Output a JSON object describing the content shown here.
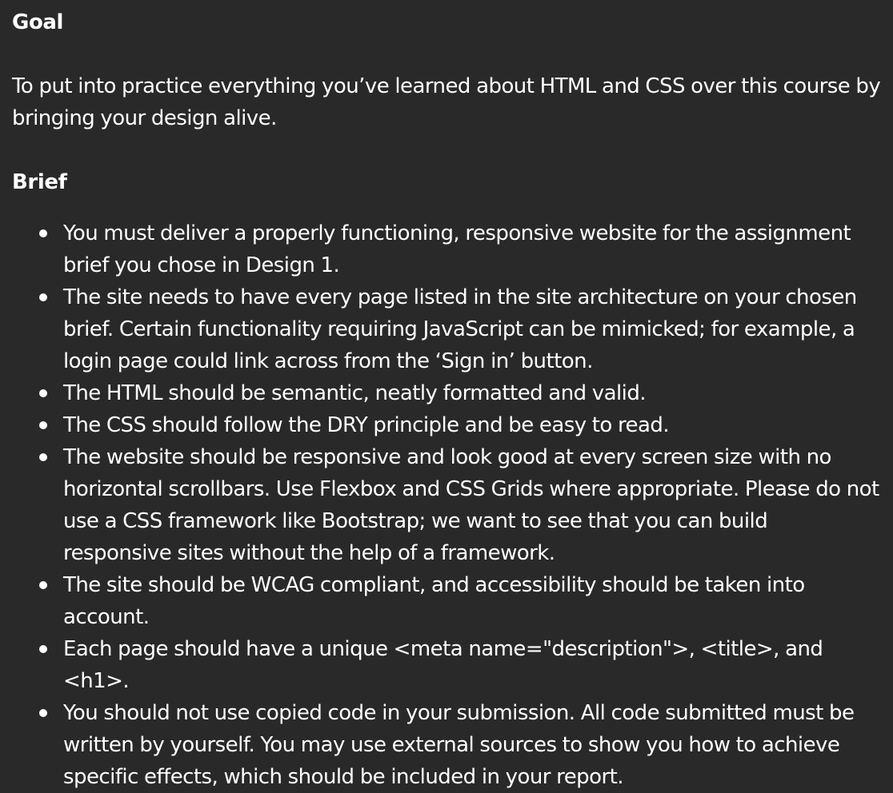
{
  "goal": {
    "heading": "Goal",
    "text": "To put into practice everything you’ve learned about HTML and CSS over this course by bringing your design alive."
  },
  "brief": {
    "heading": "Brief",
    "items": [
      "You must deliver a properly functioning, responsive website for the assignment brief you chose in Design 1.",
      "The site needs to have every page listed in the site architecture on your chosen brief. Certain functionality requiring JavaScript can be mimicked; for example, a login page could link across from the ‘Sign in’ button.",
      "The HTML should be semantic, neatly formatted and valid.",
      "The CSS should follow the DRY principle and be easy to read.",
      "The website should be responsive and look good at every screen size with no horizontal scrollbars. Use Flexbox and CSS Grids where appropriate. Please do not use a CSS framework like Bootstrap; we want to see that you can build responsive sites without the help of a framework.",
      "The site should be WCAG compliant, and accessibility should be taken into account.",
      "Each page should have a unique <meta name=\"description\">, <title>, and <h1>.",
      "You should not use copied code in your submission. All code submitted must be written by yourself. You may use external sources to show you how to achieve specific effects, which should be included in your report."
    ]
  }
}
